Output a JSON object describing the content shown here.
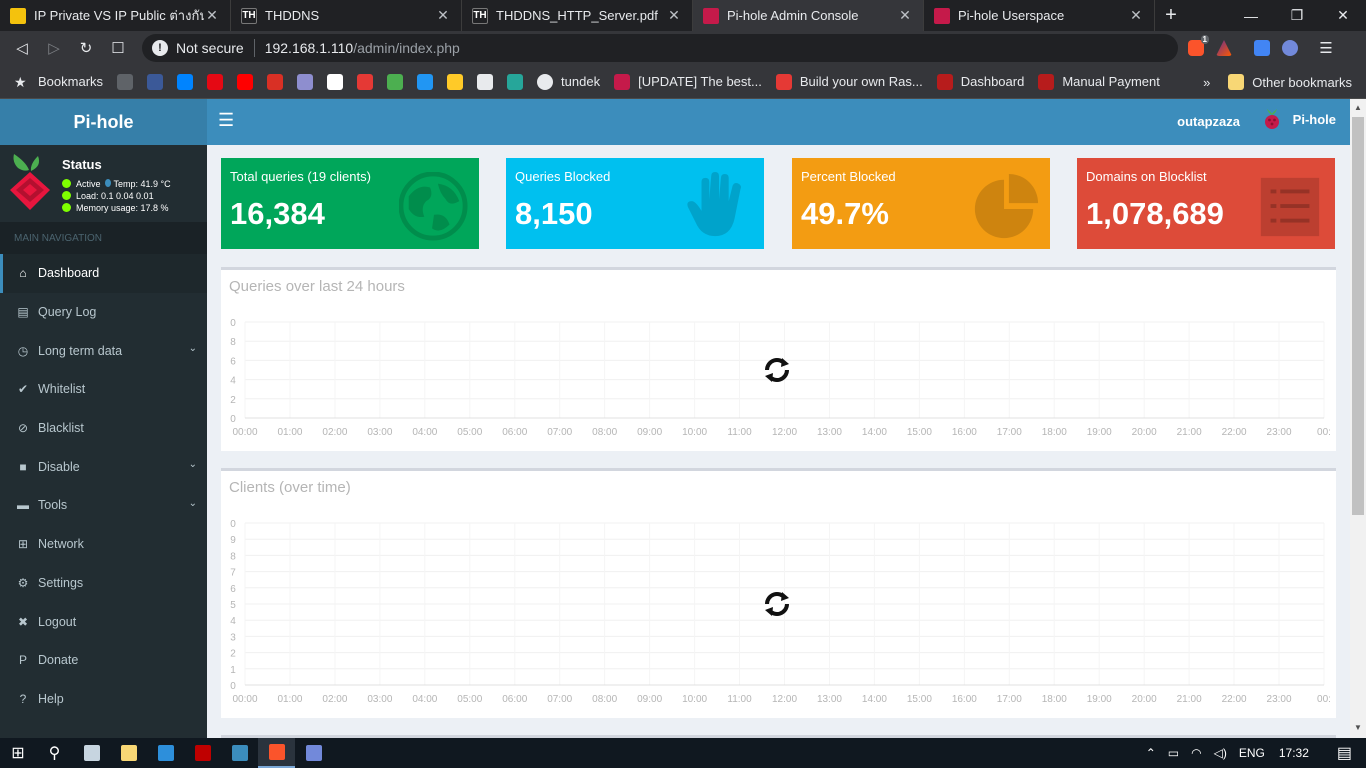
{
  "browser": {
    "tabs": [
      {
        "title": "IP Private VS IP Public ต่างกันอย่างไร",
        "fav_color": "#f4c20d",
        "fav_text": "",
        "active": false
      },
      {
        "title": "THDDNS",
        "fav_color": "#202124",
        "fav_text": "TH",
        "active": false
      },
      {
        "title": "THDDNS_HTTP_Server.pdf",
        "fav_color": "#202124",
        "fav_text": "TH",
        "active": false
      },
      {
        "title": "Pi-hole Admin Console",
        "fav_color": "#c51a4a",
        "fav_text": "",
        "active": true
      },
      {
        "title": "Pi-hole Userspace",
        "fav_color": "#c51a4a",
        "fav_text": "",
        "active": false
      }
    ],
    "new_tab": "+",
    "close_glyph": "✕",
    "window": {
      "minimize": "—",
      "restore": "❐",
      "close": "✕"
    },
    "nav": {
      "back": "◁",
      "forward": "▷",
      "reload": "↻",
      "bookmark": "☐"
    },
    "omnibox": {
      "warning": "!",
      "security_label": "Not secure",
      "host": "192.168.1.110",
      "path": "/admin/index.php"
    },
    "brave_badge": "1",
    "menu": "☰",
    "bookmarks": [
      {
        "label": "Bookmarks",
        "color": "#e8eaed",
        "glyph": "★"
      },
      {
        "label": "",
        "color": "#5f6368"
      },
      {
        "label": "",
        "color": "#3b5998"
      },
      {
        "label": "",
        "color": "#0084ff"
      },
      {
        "label": "",
        "color": "#e50914"
      },
      {
        "label": "",
        "color": "#ff0000"
      },
      {
        "label": "",
        "color": "#d93025"
      },
      {
        "label": "",
        "color": "#8e8ecf"
      },
      {
        "label": "",
        "color": "#ffffff"
      },
      {
        "label": "",
        "color": "#e53935"
      },
      {
        "label": "",
        "color": "#4caf50"
      },
      {
        "label": "",
        "color": "#2196f3"
      },
      {
        "label": "",
        "color": "#ffca28"
      },
      {
        "label": "",
        "color": "#e8eaed"
      },
      {
        "label": "",
        "color": "#26a69a"
      },
      {
        "label": "tundek",
        "color": "#e8eaed"
      },
      {
        "label": "[UPDATE] The best...",
        "color": "#c51a4a"
      },
      {
        "label": "Build your own Ras...",
        "color": "#e53935"
      },
      {
        "label": "Dashboard",
        "color": "#b71c1c"
      },
      {
        "label": "Manual Payment",
        "color": "#b71c1c"
      }
    ],
    "bookmarks_more": "»",
    "other_bookmarks": "Other bookmarks"
  },
  "header": {
    "logo": "Pi-hole",
    "toggle": "☰",
    "user": "outapzaza",
    "brand": "Pi-hole"
  },
  "sidebar": {
    "status_title": "Status",
    "status_active": "Active",
    "status_temp": "Temp: 41.9 °C",
    "status_load": "Load:  0.1  0.04  0.01",
    "status_memory": "Memory usage:  17.8 %",
    "nav_header": "MAIN NAVIGATION",
    "items": [
      {
        "label": "Dashboard",
        "icon": "home-icon",
        "glyph": "⌂",
        "active": true,
        "chevron": false
      },
      {
        "label": "Query Log",
        "icon": "file-icon",
        "glyph": "▤",
        "active": false,
        "chevron": false
      },
      {
        "label": "Long term data",
        "icon": "clock-icon",
        "glyph": "◷",
        "active": false,
        "chevron": true
      },
      {
        "label": "Whitelist",
        "icon": "check-circle-icon",
        "glyph": "✔",
        "active": false,
        "chevron": false
      },
      {
        "label": "Blacklist",
        "icon": "ban-icon",
        "glyph": "⊘",
        "active": false,
        "chevron": false
      },
      {
        "label": "Disable",
        "icon": "stop-icon",
        "glyph": "■",
        "active": false,
        "chevron": true
      },
      {
        "label": "Tools",
        "icon": "folder-icon",
        "glyph": "▬",
        "active": false,
        "chevron": true
      },
      {
        "label": "Network",
        "icon": "network-icon",
        "glyph": "⊞",
        "active": false,
        "chevron": false
      },
      {
        "label": "Settings",
        "icon": "gears-icon",
        "glyph": "⚙",
        "active": false,
        "chevron": false
      },
      {
        "label": "Logout",
        "icon": "user-times-icon",
        "glyph": "✖",
        "active": false,
        "chevron": false
      },
      {
        "label": "Donate",
        "icon": "paypal-icon",
        "glyph": "P",
        "active": false,
        "chevron": false
      },
      {
        "label": "Help",
        "icon": "question-circle-icon",
        "glyph": "?",
        "active": false,
        "chevron": false
      }
    ],
    "chevron": "⌄"
  },
  "stats": [
    {
      "label": "Total queries (19 clients)",
      "value": "16,384",
      "color": "#00a65a",
      "icon": "globe-icon"
    },
    {
      "label": "Queries Blocked",
      "value": "8,150",
      "color": "#00c0ef",
      "icon": "hand-icon"
    },
    {
      "label": "Percent Blocked",
      "value": "49.7%",
      "color": "#f39c12",
      "icon": "pie-chart-icon"
    },
    {
      "label": "Domains on Blocklist",
      "value": "1,078,689",
      "color": "#dd4b39",
      "icon": "list-icon"
    }
  ],
  "chart_data": [
    {
      "type": "line",
      "title": "Queries over last 24 hours",
      "y_ticks": [
        "0",
        "8",
        "6",
        "4",
        "2",
        "0"
      ],
      "x": [
        "00:00",
        "01:00",
        "02:00",
        "03:00",
        "04:00",
        "05:00",
        "06:00",
        "07:00",
        "08:00",
        "09:00",
        "10:00",
        "11:00",
        "12:00",
        "13:00",
        "14:00",
        "15:00",
        "16:00",
        "17:00",
        "18:00",
        "19:00",
        "20:00",
        "21:00",
        "22:00",
        "23:00",
        "00:"
      ],
      "grid": true,
      "loading": true
    },
    {
      "type": "line",
      "title": "Clients (over time)",
      "y_ticks": [
        "0",
        "9",
        "8",
        "7",
        "6",
        "5",
        "4",
        "3",
        "2",
        "1",
        "0"
      ],
      "x": [
        "00:00",
        "01:00",
        "02:00",
        "03:00",
        "04:00",
        "05:00",
        "06:00",
        "07:00",
        "08:00",
        "09:00",
        "10:00",
        "11:00",
        "12:00",
        "13:00",
        "14:00",
        "15:00",
        "16:00",
        "17:00",
        "18:00",
        "19:00",
        "20:00",
        "21:00",
        "22:00",
        "23:00",
        "00:"
      ],
      "grid": true,
      "loading": true
    }
  ],
  "taskbar": {
    "apps": [
      {
        "name": "start-button",
        "color": "#ffffff",
        "glyph": "⊞"
      },
      {
        "name": "search-button",
        "color": "#ffffff",
        "glyph": "⚲"
      },
      {
        "name": "steam-app",
        "color": "#c7d5e0"
      },
      {
        "name": "file-explorer-app",
        "color": "#f8d775"
      },
      {
        "name": "vscode-app",
        "color": "#2d8fdb"
      },
      {
        "name": "filezilla-app",
        "color": "#bf0000"
      },
      {
        "name": "vnc-app",
        "color": "#3b8dbd"
      },
      {
        "name": "brave-app",
        "color": "#fb542b"
      },
      {
        "name": "discord-app",
        "color": "#7289da"
      }
    ],
    "active_index": 7,
    "tray_chevron": "⌃",
    "language": "ENG",
    "time": "17:32",
    "notification": "▤"
  }
}
